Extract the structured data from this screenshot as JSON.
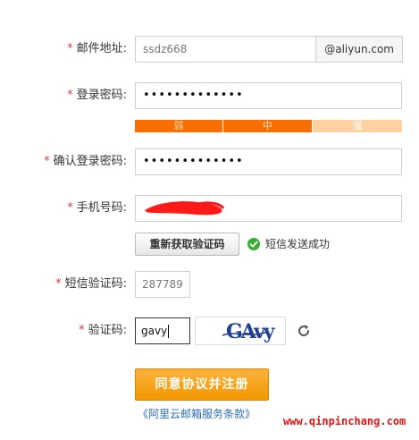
{
  "form": {
    "required_mark": "*",
    "email": {
      "label": "邮件地址:",
      "value": "ssdz668",
      "suffix": "@aliyun.com"
    },
    "password": {
      "label": "登录密码:",
      "value": "•••••••••••••"
    },
    "strength": {
      "weak": "弱",
      "medium": "中",
      "strong": "强"
    },
    "confirm_password": {
      "label": "确认登录密码:",
      "value": "•••••••••••••"
    },
    "phone": {
      "label": "手机号码:"
    },
    "resend_button": "重新获取验证码",
    "sms_status": "短信发送成功",
    "sms_code": {
      "label": "短信验证码:",
      "value": "287789"
    },
    "captcha": {
      "label": "验证码:",
      "value": "gavy",
      "image_text": "GAvy"
    },
    "submit_button": "同意协议并注册",
    "terms_link": "《阿里云邮箱服务条款》"
  },
  "watermark": "www.qinpinchang.com",
  "colors": {
    "required": "#e4393c",
    "strength_fill": "#f96e00",
    "strength_empty": "#fdd1a1",
    "submit": "#f39800",
    "link": "#2a6cb8",
    "success": "#3cac38",
    "redaction": "#ff1a1a"
  },
  "icons": {
    "success": "check-circle-icon",
    "refresh": "refresh-icon"
  }
}
